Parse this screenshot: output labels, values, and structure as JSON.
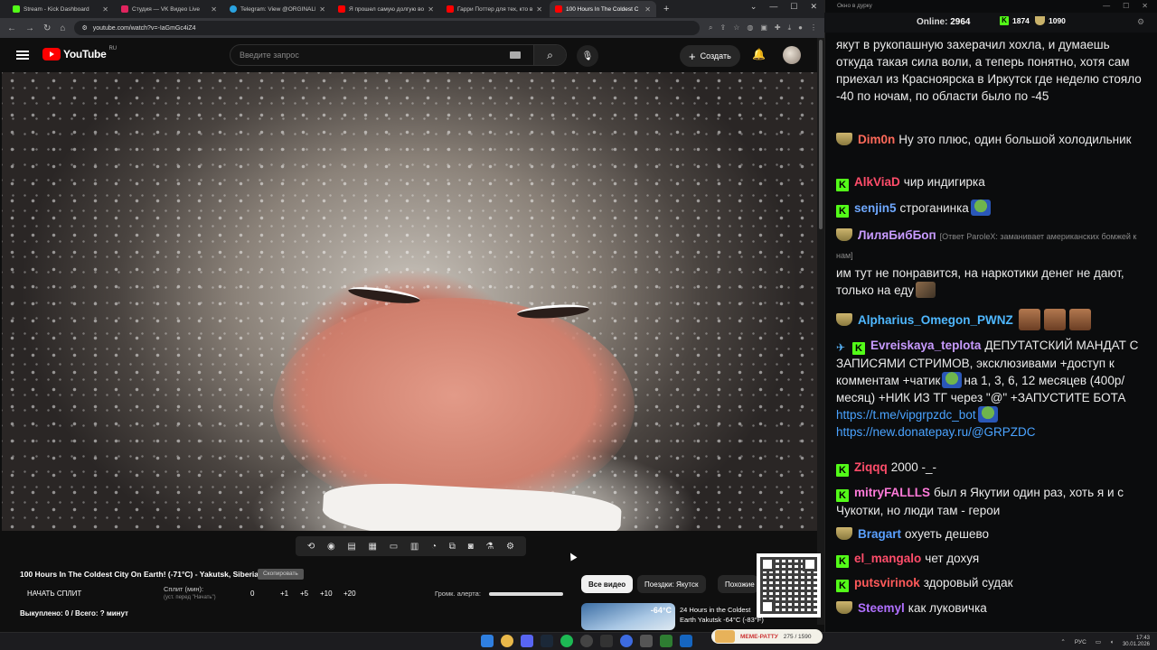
{
  "browser": {
    "tabs": [
      {
        "title": "Stream - Kick Dashboard",
        "color": "#53fc18"
      },
      {
        "title": "Студия — VK Видео Live",
        "color": "#e0245e"
      },
      {
        "title": "Telegram: View @ORGINALDAI",
        "color": "#2aa3e0"
      },
      {
        "title": "Я прошел самую долгую войн",
        "color": "#ff0000"
      },
      {
        "title": "Гарри Поттер для тех, кто вы",
        "color": "#ff0000"
      },
      {
        "title": "100 Hours In The Coldest C",
        "color": "#ff0000",
        "active": true
      }
    ],
    "url": "youtube.com/watch?v=-IaGmGc4iZ4"
  },
  "youtube": {
    "logo_text": "YouTube",
    "region": "RU",
    "search_placeholder": "Введите запрос",
    "create_label": "Создать"
  },
  "video": {
    "title": "100 Hours In The Coldest City On Earth! (-71°C) - Yakutsk, Siberia",
    "badge": "Скопировать"
  },
  "panel": {
    "split_button": "НАЧАТЬ СПЛИТ",
    "split_label": "Сплит (мин):",
    "split_hint": "(уст. перед \"Начать\")",
    "adjust": [
      "0",
      "+1",
      "+5",
      "+10",
      "+20"
    ],
    "alert_volume_label": "Громк. алерта:",
    "alert_volume": 1.0,
    "paid": "Выкуплено: 0 / Всего: ? минут"
  },
  "recommendations": {
    "chips": [
      "Все видео",
      "Поездки: Якутск",
      "Похожие"
    ],
    "first": {
      "temp": "-64°C",
      "title": "24 Hours in the Coldest Earth Yakutsk -64°C (-83°F)"
    }
  },
  "chat": {
    "window_title": "Окно в дурку",
    "online_label": "Online:",
    "online_count": "2964",
    "kick_count": "1874",
    "cup_count": "1090",
    "messages": [
      {
        "badge": "none",
        "nick": "",
        "nick_color": "#ffffff",
        "text": "якут в рукопашную захерачил хохла, и думаешь откуда такая сила воли, а теперь понятно, хотя сам приехал из Красноярска в Иркутск где неделю стояло -40 по ночам, по области было по -45"
      },
      {
        "badge": "cup",
        "nick": "Dim0n",
        "nick_color": "#ff6a5a",
        "text": "Ну это плюс, один большой холодильник"
      },
      {
        "badge": "kick",
        "nick": "AlkViaD",
        "nick_color": "#ff4d6a",
        "text": "чир индигирка"
      },
      {
        "badge": "kick",
        "nick": "senjin5",
        "nick_color": "#6fa8ff",
        "text": "строганинка"
      },
      {
        "badge": "cup",
        "nick": "ЛиляБибБоп",
        "nick_color": "#c89bff",
        "reply": "[Ответ ParoleX: заманивает американских бомжей к нам]",
        "text": "им тут не понравится, на наркотики денег не дают, только на еду"
      },
      {
        "badge": "cup",
        "nick": "Alpharius_Omegon_PWNZ",
        "nick_color": "#4fb8ff",
        "text": ""
      },
      {
        "badge": "sword-kick",
        "nick": "Evreiskaya_teplota",
        "nick_color": "#c89bff",
        "text": "ДЕПУТАТСКИЙ МАНДАТ С ЗАПИСЯМИ СТРИМОВ, эксклюзивами +доступ к комментам +чатик",
        "text2": "на 1, 3, 6, 12 месяцев (400р/месяц) +НИК ИЗ ТГ через \"@\" +ЗАПУСТИТЕ БОТА",
        "link1": "https://t.me/vipgrpzdc_bot",
        "link2": "https://new.donatepay.ru/@GRPZDC"
      },
      {
        "badge": "kick",
        "nick": "Ziqqq",
        "nick_color": "#ff4d6a",
        "text": "2000 -_-"
      },
      {
        "badge": "kick",
        "nick": "mitryFALLLS",
        "nick_color": "#ff7ad9",
        "text": "был я Якутии один раз, хоть я и с Чукотки, но люди там - герои"
      },
      {
        "badge": "cup",
        "nick": "Bragart",
        "nick_color": "#5aa0ff",
        "text": "охуеть дешево"
      },
      {
        "badge": "kick",
        "nick": "el_mangalo",
        "nick_color": "#ff4d6a",
        "text": "чет дохуя"
      },
      {
        "badge": "kick",
        "nick": "putsvirinok",
        "nick_color": "#ff5a5a",
        "text": "здоровый судак"
      },
      {
        "badge": "cup",
        "nick": "Steemyl",
        "nick_color": "#b070ff",
        "text": "как луковичка"
      }
    ]
  },
  "taskbar": {
    "overlay_text": "275 / 1590",
    "overlay_label": "МЕМЕ-РАТТУ",
    "lang": "РУС",
    "time": "17:43",
    "date": "30.01.2026"
  },
  "colors": {
    "yt_red": "#ff0000",
    "kick_green": "#53fc18",
    "link": "#4aa3ff"
  }
}
